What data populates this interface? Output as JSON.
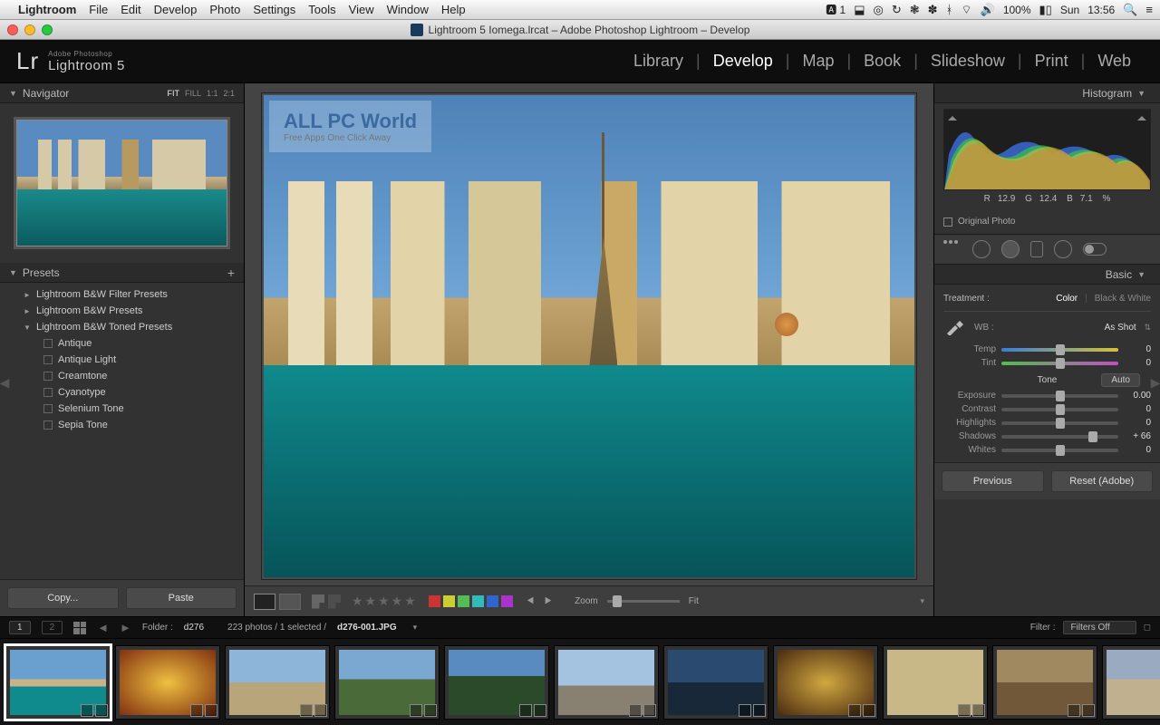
{
  "mac_menu": {
    "app": "Lightroom",
    "items": [
      "File",
      "Edit",
      "Develop",
      "Photo",
      "Settings",
      "Tools",
      "View",
      "Window",
      "Help"
    ],
    "status": {
      "badge": "1",
      "battery": "100%",
      "day": "Sun",
      "time": "13:56"
    }
  },
  "window": {
    "title": "Lightroom 5 Iomega.lrcat – Adobe Photoshop Lightroom – Develop"
  },
  "app_header": {
    "logo_small": "Adobe Photoshop",
    "logo_big": "Lightroom 5",
    "modules": [
      "Library",
      "Develop",
      "Map",
      "Book",
      "Slideshow",
      "Print",
      "Web"
    ],
    "active_module": "Develop"
  },
  "navigator": {
    "title": "Navigator",
    "zoom_levels": [
      "FIT",
      "FILL",
      "1:1",
      "2:1"
    ],
    "active_zoom": "FIT"
  },
  "presets": {
    "title": "Presets",
    "groups": [
      {
        "label": "Lightroom B&W Filter Presets",
        "open": false
      },
      {
        "label": "Lightroom B&W Presets",
        "open": false
      },
      {
        "label": "Lightroom B&W Toned Presets",
        "open": true,
        "items": [
          "Antique",
          "Antique Light",
          "Creamtone",
          "Cyanotype",
          "Selenium Tone",
          "Sepia Tone"
        ]
      }
    ]
  },
  "left_buttons": {
    "copy": "Copy...",
    "paste": "Paste"
  },
  "histogram": {
    "title": "Histogram",
    "readout": {
      "r": "12.9",
      "g": "12.4",
      "b": "7.1",
      "suffix": "%"
    },
    "original_label": "Original Photo"
  },
  "basic": {
    "title": "Basic",
    "treatment_label": "Treatment :",
    "treatment_options": [
      "Color",
      "Black & White"
    ],
    "treatment_active": "Color",
    "wb_label": "WB :",
    "wb_value": "As Shot",
    "sliders_wb": [
      {
        "label": "Temp",
        "value": "0",
        "track": "temp"
      },
      {
        "label": "Tint",
        "value": "0",
        "track": "tint"
      }
    ],
    "tone_label": "Tone",
    "auto_label": "Auto",
    "sliders_tone": [
      {
        "label": "Exposure",
        "value": "0.00",
        "pos": 50
      },
      {
        "label": "Contrast",
        "value": "0",
        "pos": 50
      },
      {
        "label": "Highlights",
        "value": "0",
        "pos": 50
      },
      {
        "label": "Shadows",
        "value": "+ 66",
        "pos": 78
      },
      {
        "label": "Whites",
        "value": "0",
        "pos": 50
      }
    ]
  },
  "right_buttons": {
    "prev": "Previous",
    "reset": "Reset (Adobe)"
  },
  "watermark": {
    "title": "ALL PC World",
    "sub": "Free Apps One Click Away"
  },
  "toolbar": {
    "color_chips": [
      "#c33",
      "#cc3",
      "#5b5",
      "#3bb",
      "#36c",
      "#a3c"
    ],
    "zoom_min": "Zoom",
    "zoom_max": "Fit"
  },
  "filmstrip_info": {
    "pages": [
      "1",
      "2"
    ],
    "folder_label": "Folder :",
    "folder_value": "d276",
    "count_text": "223 photos / 1 selected /",
    "filename": "d276-001.JPG",
    "filter_label": "Filter :",
    "filter_value": "Filters Off"
  },
  "thumbnails": [
    {
      "bg": "linear-gradient(#6aa0d0 0 45%,#c9b48a 45% 56%,#0f8a8d 56% 100%)",
      "selected": true
    },
    {
      "bg": "radial-gradient(#f0c040,#803010)"
    },
    {
      "bg": "linear-gradient(#8db4d9 0 50%,#b8a67a 50% 100%)"
    },
    {
      "bg": "linear-gradient(#7aa8d0 0 45%,#4a6a3a 45% 100%)"
    },
    {
      "bg": "linear-gradient(#5a8bc0 0 40%,#2a4a2a 40% 100%)"
    },
    {
      "bg": "linear-gradient(#a3c3e0 0 55%,#888070 55% 100%)"
    },
    {
      "bg": "linear-gradient(#2a4a70 0 50%,#182838 50% 100%)"
    },
    {
      "bg": "radial-gradient(#d0a840,#4a2a10)"
    },
    {
      "bg": "linear-gradient(#c8b888 0 100%)"
    },
    {
      "bg": "linear-gradient(#a08860 0 50%,#705838 50% 100%)"
    },
    {
      "bg": "linear-gradient(#9aaac0 0 45%,#c0b090 45% 100%)"
    }
  ]
}
